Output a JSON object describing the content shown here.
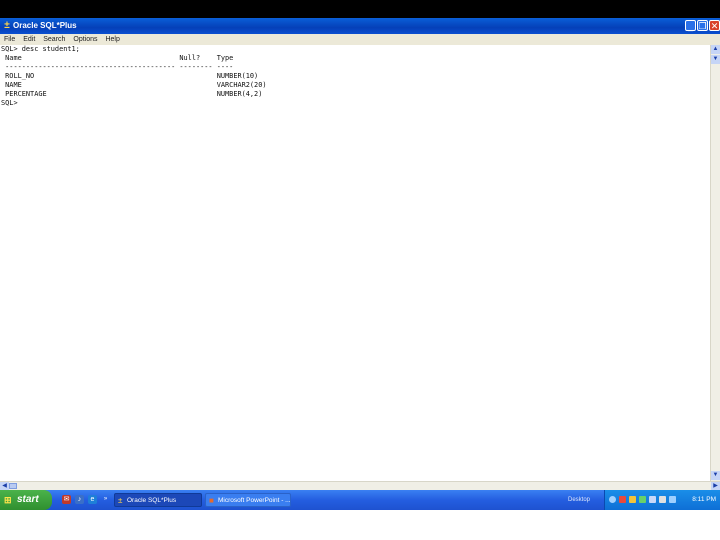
{
  "window": {
    "title": "Oracle SQL*Plus",
    "minimize": "_",
    "maximize": "❐",
    "close": "✕"
  },
  "menu": [
    "File",
    "Edit",
    "Search",
    "Options",
    "Help"
  ],
  "console": {
    "lines": [
      "SQL> desc student1;",
      " Name                                      Null?    Type",
      " ----------------------------------------- -------- ----",
      " ROLL_NO                                            NUMBER(10)",
      " NAME                                               VARCHAR2(20)",
      " PERCENTAGE                                         NUMBER(4,2)",
      "",
      "SQL> "
    ]
  },
  "taskbar": {
    "start_label": "start",
    "buttons": [
      "Oracle SQL*Plus",
      "Microsoft PowerPoint - ..."
    ],
    "desktop_label": "Desktop",
    "clock": "8:11 PM"
  },
  "colors": {
    "title_bar": "#0a4fd0",
    "taskbar": "#245ee0",
    "start_button": "#3aa13a",
    "console_bg": "#ffffff"
  }
}
